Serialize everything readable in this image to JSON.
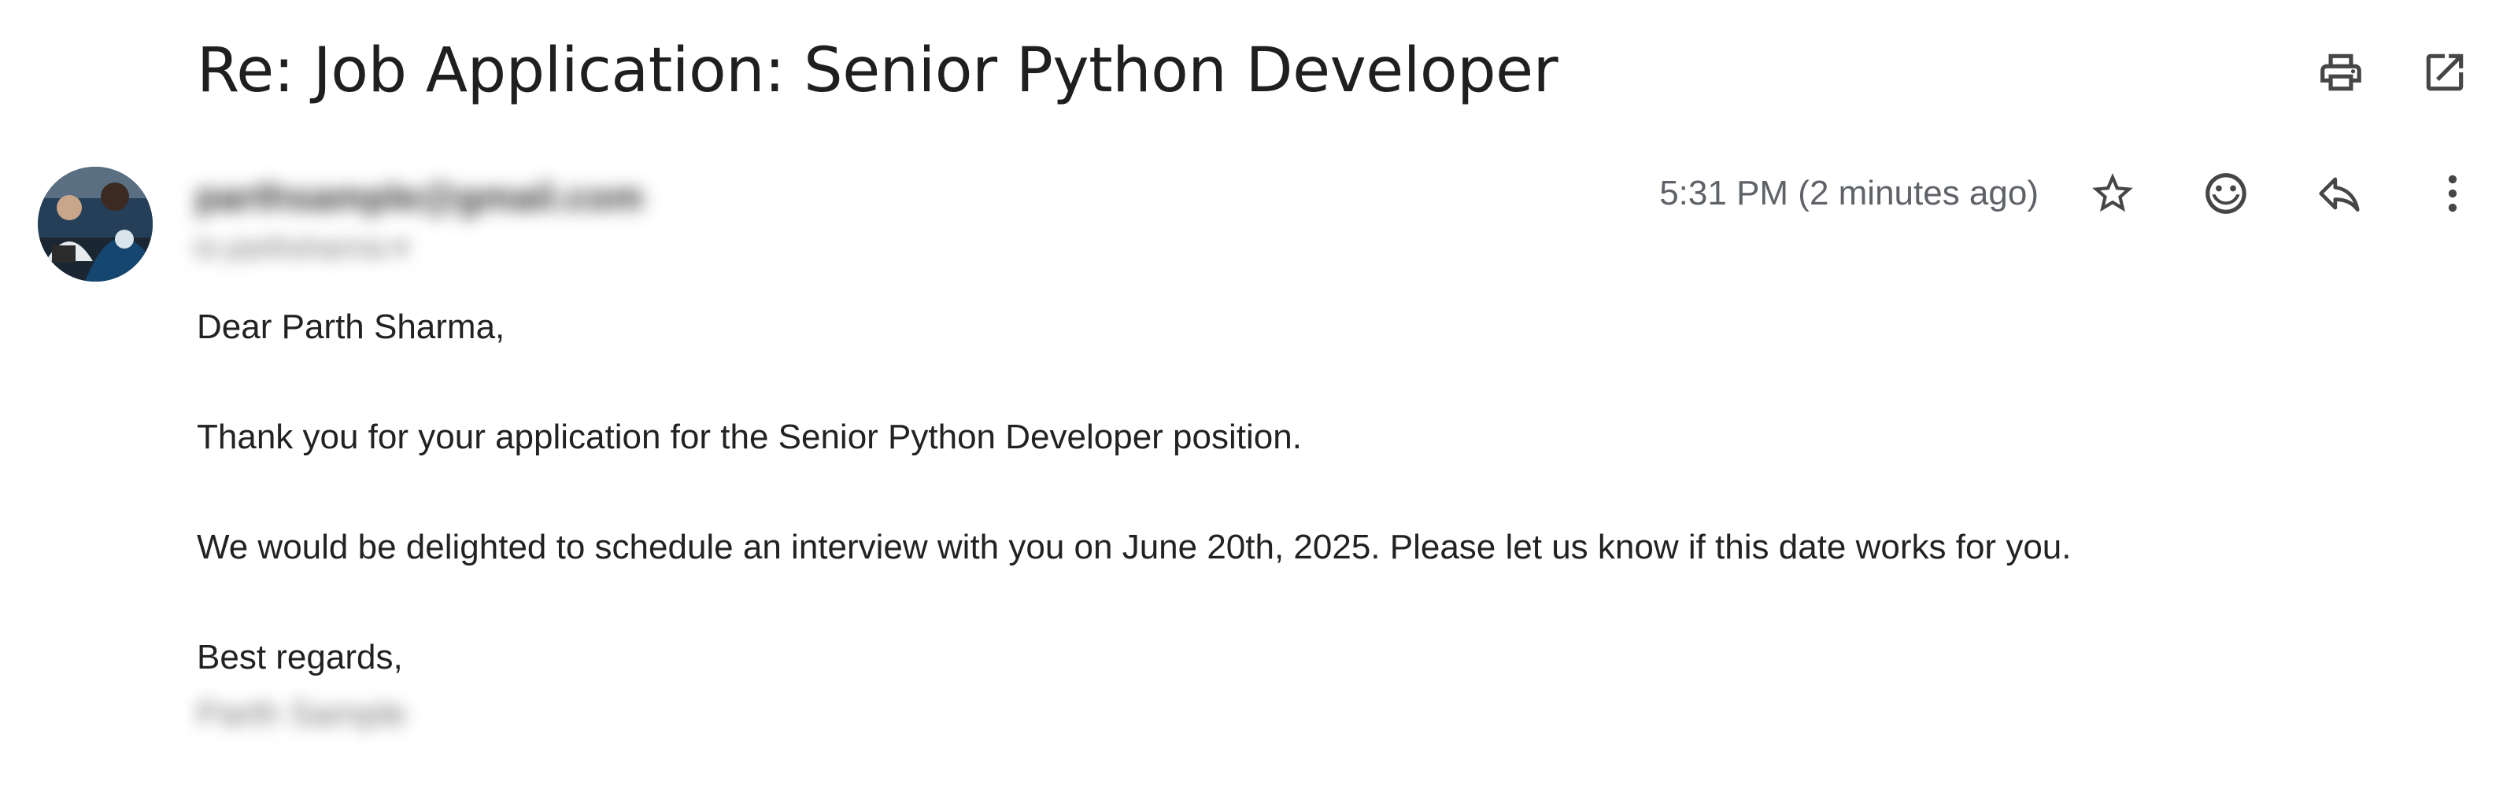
{
  "email": {
    "subject": "Re: Job Application: Senior Python Developer",
    "sender": {
      "email": "parthsample@gmail.com",
      "to_line": "to parthsharma ▾"
    },
    "timestamp": "5:31 PM (2 minutes ago)",
    "body": {
      "greeting": "Dear Parth Sharma,",
      "paragraph1": "Thank you for your application for the Senior Python Developer position.",
      "paragraph2": "We would be delighted to schedule an interview with you on June 20th, 2025. Please let us know if this date works for you.",
      "closing": "Best regards,",
      "signature": "Parth Sample"
    }
  },
  "icons": {
    "print": "print-icon",
    "open_new_window": "open-in-new-icon",
    "star": "star-icon",
    "emoji": "emoji-icon",
    "reply": "reply-icon",
    "more": "more-vert-icon"
  },
  "colors": {
    "icon": "#444746",
    "timestamp": "#5f6368",
    "text": "#222222"
  }
}
